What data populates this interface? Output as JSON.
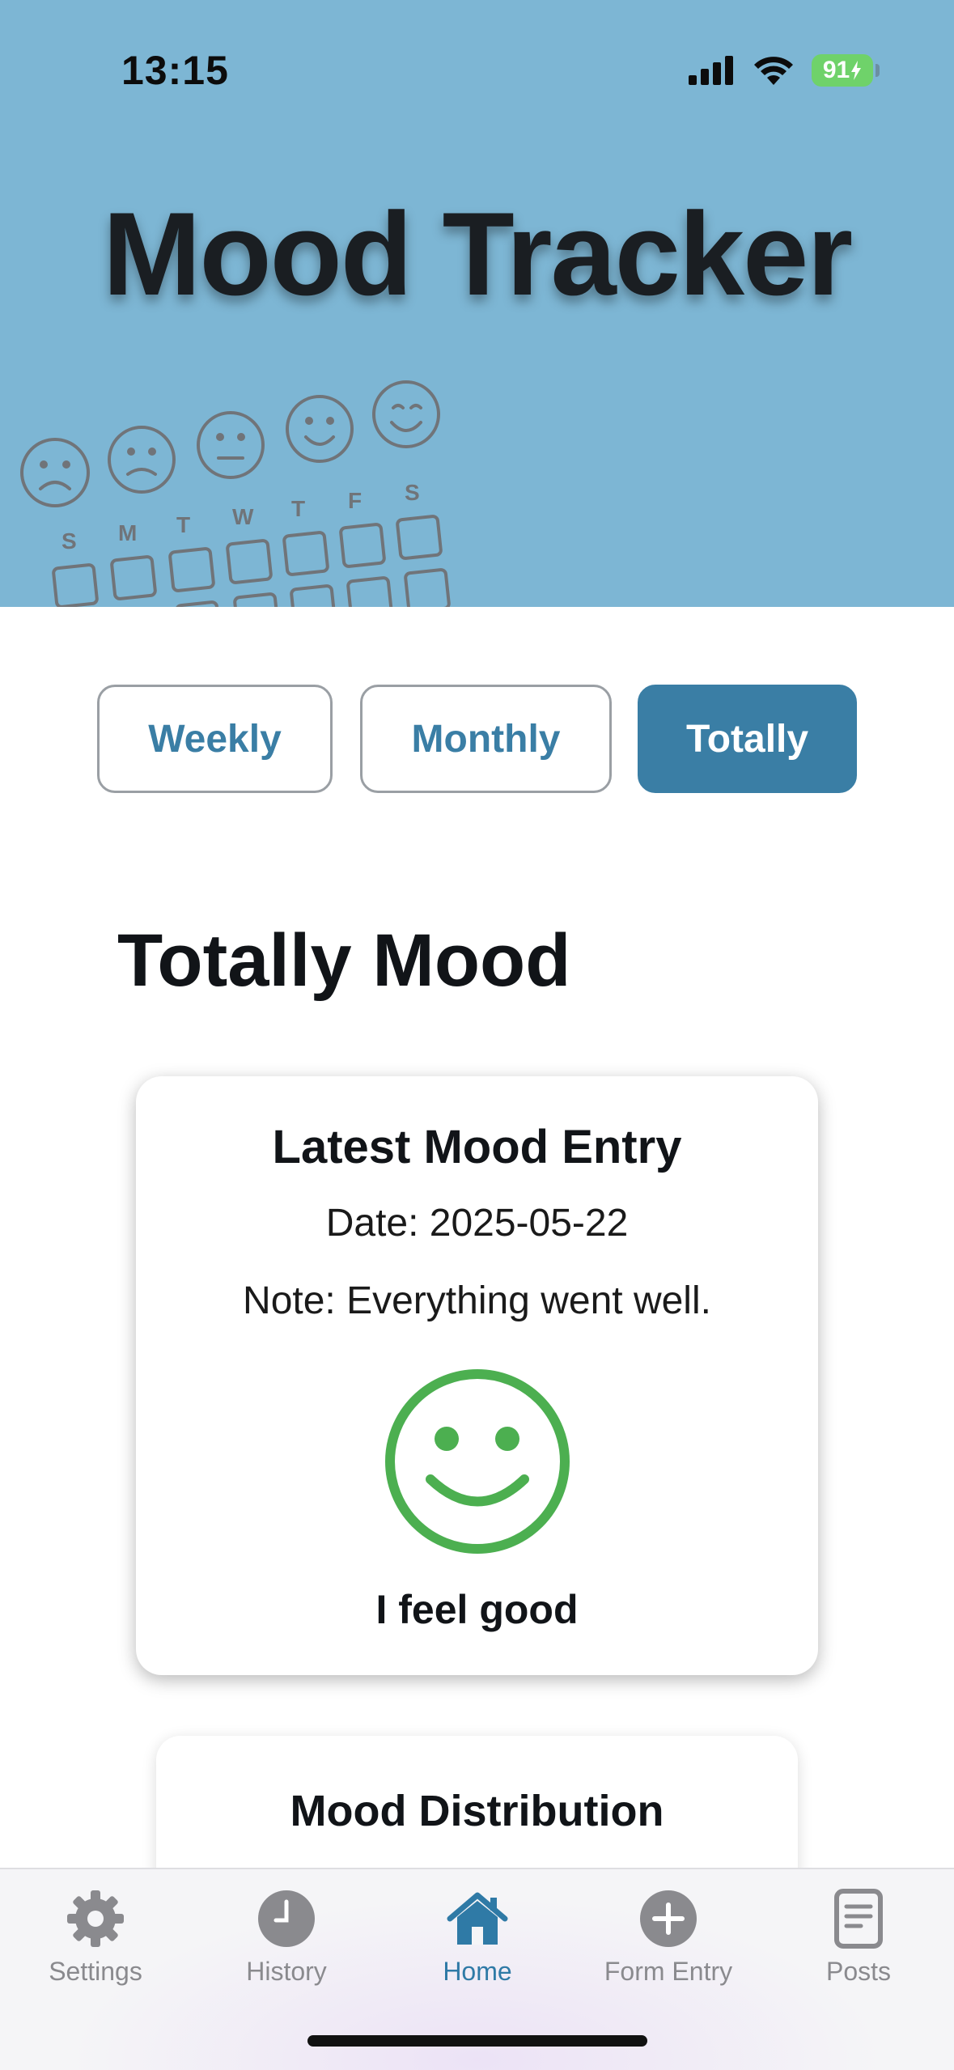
{
  "status_bar": {
    "time": "13:15",
    "battery": "91",
    "icons": [
      "signal-icon",
      "wifi-icon",
      "battery-charging-icon"
    ]
  },
  "header": {
    "title": "Mood Tracker",
    "weekday_letters": [
      "S",
      "M",
      "T",
      "W",
      "T",
      "F",
      "S"
    ]
  },
  "tabs": [
    {
      "label": "Weekly",
      "active": false
    },
    {
      "label": "Monthly",
      "active": false
    },
    {
      "label": "Totally",
      "active": true
    }
  ],
  "main": {
    "section_title": "Totally Mood",
    "latest_entry": {
      "title": "Latest Mood Entry",
      "date_line": "Date: 2025-05-22",
      "note_line": "Note: Everything went well.",
      "mood_icon": "smiley-face-icon",
      "mood_label": "I feel good",
      "mood_color": "#4caf50"
    },
    "distribution": {
      "title": "Mood Distribution"
    }
  },
  "tab_bar": {
    "items": [
      {
        "label": "Settings",
        "icon": "gear-icon",
        "active": false
      },
      {
        "label": "History",
        "icon": "clock-icon",
        "active": false
      },
      {
        "label": "Home",
        "icon": "home-icon",
        "active": true
      },
      {
        "label": "Form Entry",
        "icon": "plus-circle-icon",
        "active": false
      },
      {
        "label": "Posts",
        "icon": "document-icon",
        "active": false
      }
    ]
  },
  "colors": {
    "header_bg": "#7db6d4",
    "accent": "#3a7ea5",
    "inactive_tab_icon": "#8a8a8e"
  }
}
